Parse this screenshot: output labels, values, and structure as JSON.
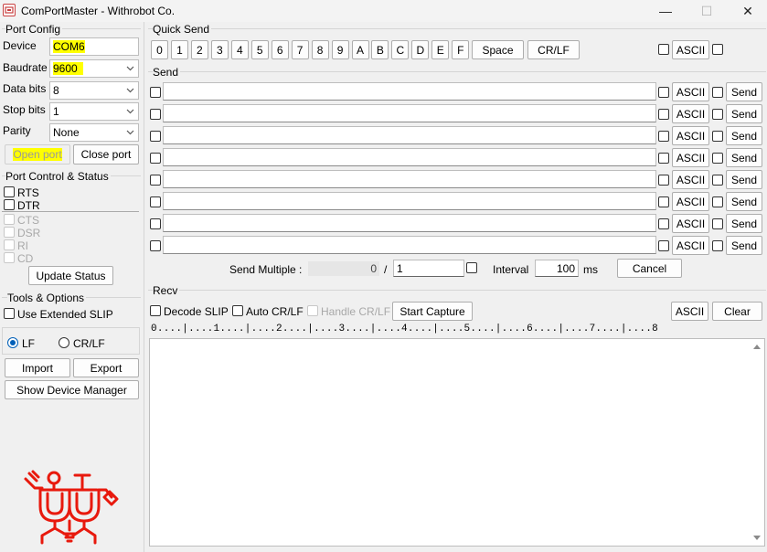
{
  "window": {
    "title": "ComPortMaster - Withrobot Co.",
    "minimize": "—",
    "maximize": "☐",
    "close": "✕"
  },
  "port_config": {
    "label": "Port Config",
    "device_label": "Device",
    "device_value": "COM6",
    "baudrate_label": "Baudrate",
    "baudrate_value": "9600",
    "databits_label": "Data bits",
    "databits_value": "8",
    "stopbits_label": "Stop bits",
    "stopbits_value": "1",
    "parity_label": "Parity",
    "parity_value": "None",
    "open_port": "Open port",
    "close_port": "Close port"
  },
  "port_control": {
    "label": "Port Control & Status",
    "rts": "RTS",
    "dtr": "DTR",
    "cts": "CTS",
    "dsr": "DSR",
    "ri": "RI",
    "cd": "CD",
    "update_status": "Update Status"
  },
  "tools": {
    "label": "Tools & Options",
    "use_slip": "Use Extended SLIP",
    "lf": "LF",
    "crlf": "CR/LF",
    "line_ending_selected": "LF",
    "import": "Import",
    "export": "Export",
    "device_manager": "Show Device Manager"
  },
  "quick_send": {
    "label": "Quick Send",
    "keys": [
      "0",
      "1",
      "2",
      "3",
      "4",
      "5",
      "6",
      "7",
      "8",
      "9",
      "A",
      "B",
      "C",
      "D",
      "E",
      "F"
    ],
    "space": "Space",
    "crlf": "CR/LF",
    "ascii": "ASCII"
  },
  "send": {
    "label": "Send",
    "rows": [
      {
        "value": "",
        "ascii": "ASCII",
        "send": "Send"
      },
      {
        "value": "",
        "ascii": "ASCII",
        "send": "Send"
      },
      {
        "value": "",
        "ascii": "ASCII",
        "send": "Send"
      },
      {
        "value": "",
        "ascii": "ASCII",
        "send": "Send"
      },
      {
        "value": "",
        "ascii": "ASCII",
        "send": "Send"
      },
      {
        "value": "",
        "ascii": "ASCII",
        "send": "Send"
      },
      {
        "value": "",
        "ascii": "ASCII",
        "send": "Send"
      },
      {
        "value": "",
        "ascii": "ASCII",
        "send": "Send"
      }
    ],
    "multiple_label": "Send Multiple :",
    "progress_value": "0",
    "slash": "/",
    "total_value": "1",
    "interval_label": "Interval",
    "interval_value": "100",
    "interval_unit": "ms",
    "cancel": "Cancel"
  },
  "recv": {
    "label": "Recv",
    "decode_slip": "Decode SLIP",
    "auto_crlf": "Auto CR/LF",
    "handle_crlf": "Handle CR/LF",
    "start_capture": "Start Capture",
    "ascii": "ASCII",
    "clear": "Clear",
    "ruler": "0....|....1....|....2....|....3....|....4....|....5....|....6....|....7....|....8"
  },
  "colors": {
    "logo": "#e8190d",
    "highlight": "#ffff00",
    "accent": "#005fb8"
  },
  "icons": {
    "app": "comport-app-icon",
    "logo": "withrobot-logo",
    "chevron": "chevron-down-icon"
  }
}
